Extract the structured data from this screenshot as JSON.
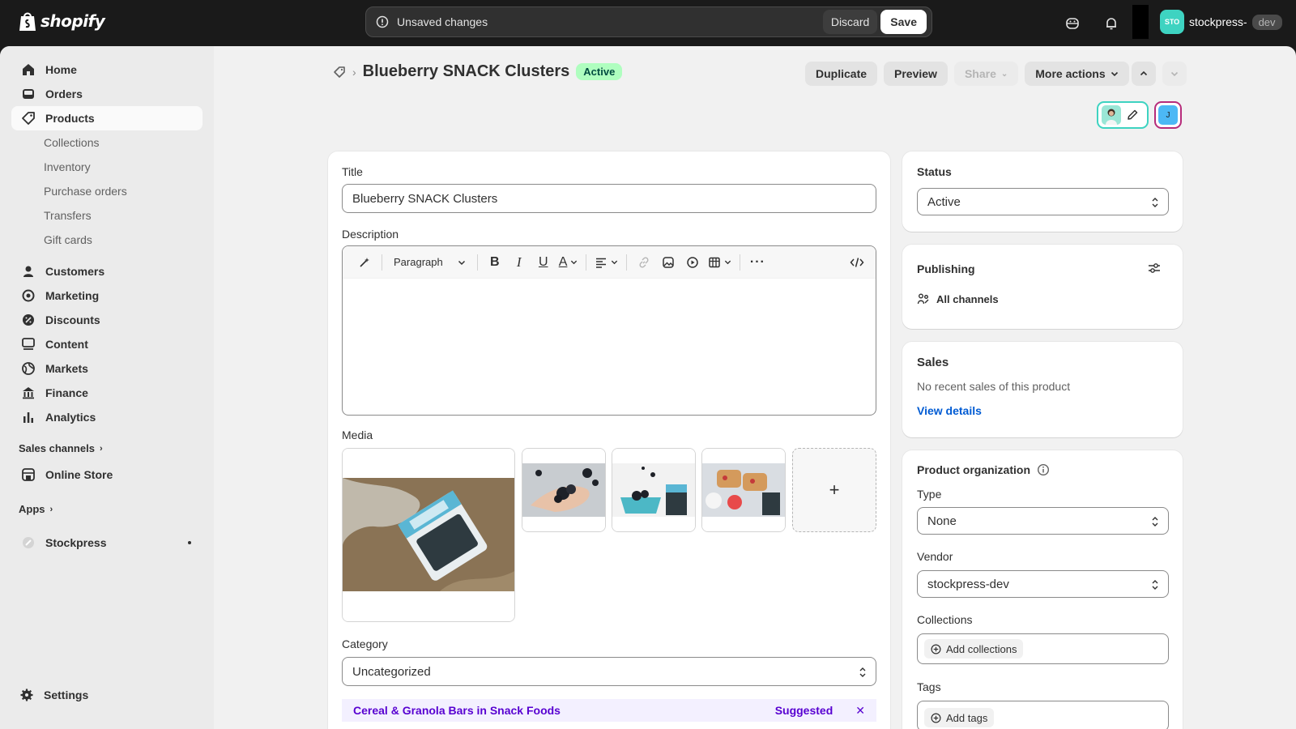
{
  "topbar": {
    "brand": "shopify",
    "unsaved_message": "Unsaved changes",
    "discard_label": "Discard",
    "save_label": "Save",
    "store_initials": "STO",
    "store_name": "stockpress-",
    "store_suffix": "dev"
  },
  "sidebar": {
    "items": [
      {
        "label": "Home"
      },
      {
        "label": "Orders"
      },
      {
        "label": "Products"
      },
      {
        "label": "Customers"
      },
      {
        "label": "Marketing"
      },
      {
        "label": "Discounts"
      },
      {
        "label": "Content"
      },
      {
        "label": "Markets"
      },
      {
        "label": "Finance"
      },
      {
        "label": "Analytics"
      }
    ],
    "product_subitems": [
      "Collections",
      "Inventory",
      "Purchase orders",
      "Transfers",
      "Gift cards"
    ],
    "sales_channels_label": "Sales channels",
    "online_store_label": "Online Store",
    "apps_label": "Apps",
    "stockpress_label": "Stockpress",
    "settings_label": "Settings"
  },
  "header": {
    "title": "Blueberry SNACK Clusters",
    "status_badge": "Active",
    "duplicate_label": "Duplicate",
    "preview_label": "Preview",
    "share_label": "Share",
    "more_actions_label": "More actions",
    "collaborator_initial": "J"
  },
  "product": {
    "title_label": "Title",
    "title_value": "Blueberry SNACK Clusters",
    "description_label": "Description",
    "paragraph_label": "Paragraph",
    "media_label": "Media",
    "add_media_symbol": "+",
    "category_label": "Category",
    "category_value": "Uncategorized",
    "suggestion_text": "Cereal & Granola Bars in Snack Foods",
    "suggested_label": "Suggested"
  },
  "status_card": {
    "heading": "Status",
    "value": "Active"
  },
  "publishing_card": {
    "heading": "Publishing",
    "channels": "All channels"
  },
  "sales_card": {
    "heading": "Sales",
    "text": "No recent sales of this product",
    "link": "View details"
  },
  "organization_card": {
    "heading": "Product organization",
    "type_label": "Type",
    "type_value": "None",
    "vendor_label": "Vendor",
    "vendor_value": "stockpress-dev",
    "collections_label": "Collections",
    "add_collections": "Add collections",
    "tags_label": "Tags",
    "add_tags": "Add tags"
  },
  "colors": {
    "topbar_bg": "#1a1a1a",
    "badge_active_bg": "#affebf",
    "link": "#005bd3",
    "suggest_text": "#5700d1",
    "store_avatar": "#3ed3c1"
  }
}
